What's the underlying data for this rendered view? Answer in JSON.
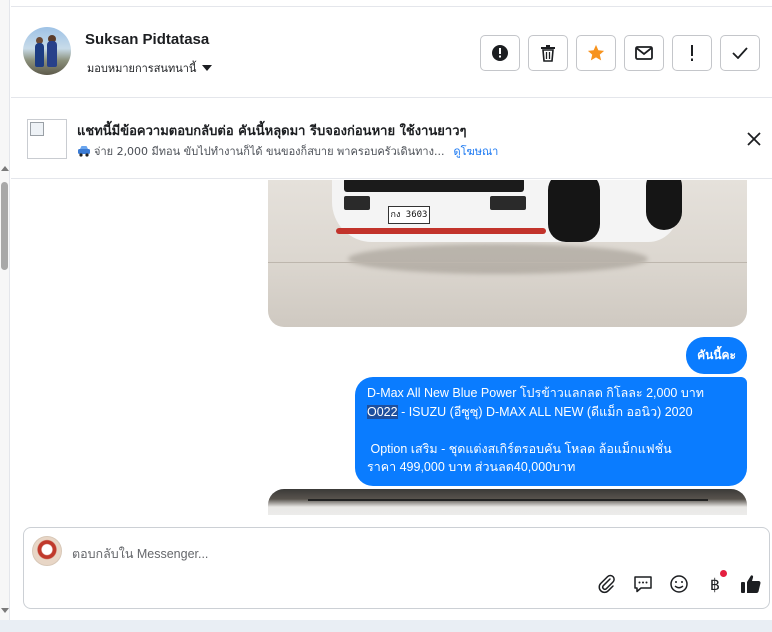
{
  "header": {
    "contact_name": "Suksan Pidtatasa",
    "assign_label": "มอบหมายการสนทนานี้",
    "actions": [
      {
        "icon": "alert-circle-icon",
        "label": "spam"
      },
      {
        "icon": "trash-icon",
        "label": "delete"
      },
      {
        "icon": "star-icon",
        "label": "follow-up"
      },
      {
        "icon": "envelope-icon",
        "label": "mark-unread"
      },
      {
        "icon": "exclamation-icon",
        "label": "mark-important"
      },
      {
        "icon": "check-icon",
        "label": "mark-done"
      }
    ],
    "star_color": "#f7931e"
  },
  "banner": {
    "title": "แชทนี้มีข้อความตอบกลับต่อ คันนี้หลุดมา รีบจองก่อนหาย ใช้งานยาวๆ",
    "subtitle": "จ่าย 2,000 มีทอน ขับไปทำงานก็ได้ ขนของก็สบาย พาครอบครัวเดินทาง...",
    "link": "ดูโฆษณา"
  },
  "messages": {
    "car_plate": "กง 3603",
    "short_reply": "คันนี้คะ",
    "long_reply_line1": "D-Max All New Blue Power โปรข้าวแลกลด กิโลละ 2,000 บาท",
    "long_reply_code": "O022",
    "long_reply_line2_rest": " - ISUZU (อีซูซุ) D-MAX ALL NEW (ดีแม็ก ออนิว) 2020",
    "long_reply_line3": " Option เสริม - ชุดแต่งสเกิร์ตรอบคัน โหลด ล้อแม็กแฟชั่น",
    "long_reply_line4": "ราคา 499,000 บาท ส่วนลด40,000บาท"
  },
  "composer": {
    "placeholder": "ตอบกลับใน Messenger...",
    "tools": [
      "paperclip-icon",
      "saved-reply-icon",
      "emoji-icon",
      "baht-icon",
      "thumbs-up-icon"
    ],
    "baht_symbol": "฿",
    "accent": "#0a7cff"
  }
}
